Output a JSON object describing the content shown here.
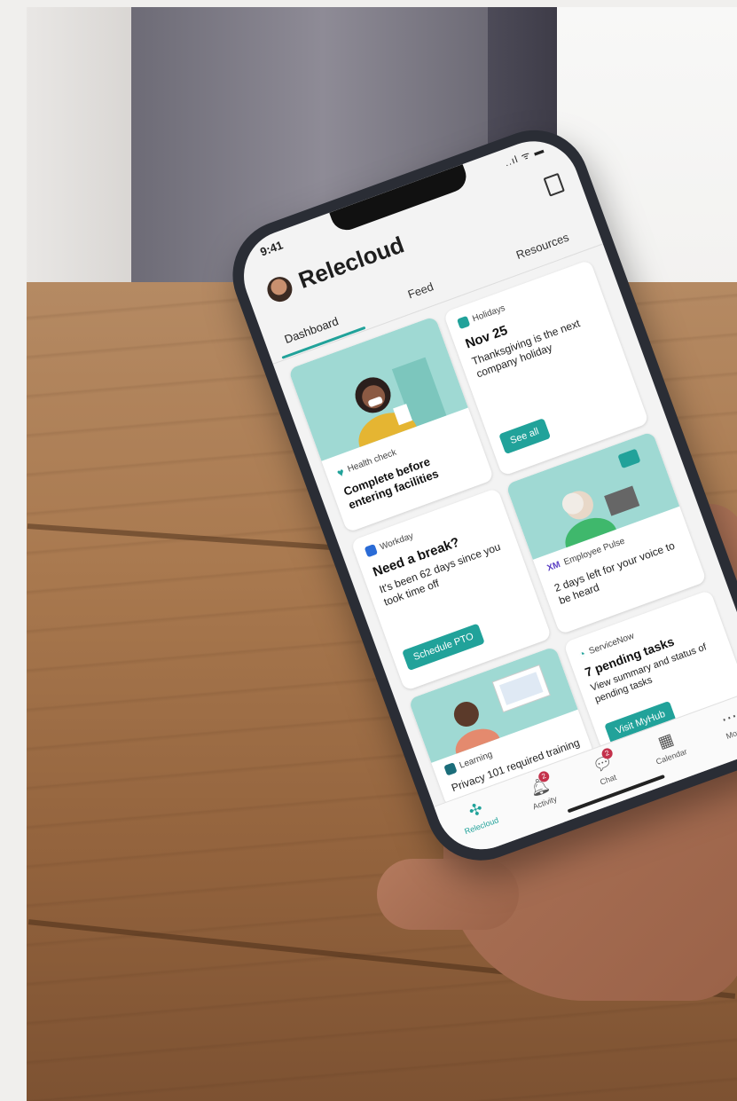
{
  "status": {
    "time": "9:41",
    "icons": "..ıl ᯤ ▬"
  },
  "app": {
    "title": "Relecloud"
  },
  "tabs": [
    {
      "label": "Dashboard",
      "active": true
    },
    {
      "label": "Feed",
      "active": false
    },
    {
      "label": "Resources",
      "active": false
    }
  ],
  "cards": {
    "health": {
      "source": "Health check",
      "heading": "Complete before entering facilities"
    },
    "holidays": {
      "source": "Holidays",
      "heading": "Nov 25",
      "text": "Thanksgiving is the next company holiday",
      "button": "See all"
    },
    "workday": {
      "source": "Workday",
      "heading": "Need a break?",
      "text": "It's been 62 days since you took time off",
      "button": "Schedule PTO"
    },
    "pulse": {
      "source": "Employee Pulse",
      "heading": "2 days left for your voice to be heard"
    },
    "learning": {
      "source": "Learning",
      "heading": "Privacy 101 required training"
    },
    "servicenow": {
      "source": "ServiceNow",
      "heading": "7 pending tasks",
      "text": "View summary and status of pending tasks",
      "button": "Visit MyHub"
    }
  },
  "nav": [
    {
      "label": "Relecloud",
      "icon": "app-icon",
      "active": true,
      "badge": ""
    },
    {
      "label": "Activity",
      "icon": "bell-icon",
      "active": false,
      "badge": "2"
    },
    {
      "label": "Chat",
      "icon": "chat-icon",
      "active": false,
      "badge": "2"
    },
    {
      "label": "Calendar",
      "icon": "calendar-icon",
      "active": false,
      "badge": ""
    },
    {
      "label": "More",
      "icon": "more-icon",
      "active": false,
      "badge": ""
    }
  ],
  "colors": {
    "accent": "#21a29a",
    "badge": "#c4314b",
    "illustration": "#9fd9d3"
  }
}
